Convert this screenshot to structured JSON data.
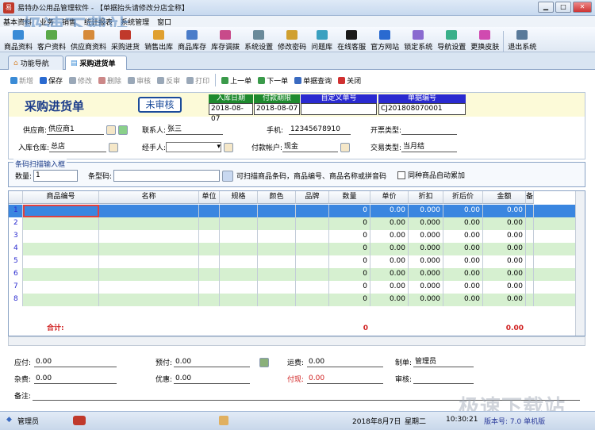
{
  "window": {
    "title": "易特办公用品管理软件 - 【单据抬头请修改分店全称】"
  },
  "watermark": "极速下载站",
  "menu": [
    "基本资料",
    "业务",
    "销售",
    "统计报表",
    "系统管理",
    "窗口"
  ],
  "toolbar": [
    {
      "label": "商品资料",
      "icon": "goods-icon",
      "color": "#3a8bd6"
    },
    {
      "label": "客户资料",
      "icon": "customer-icon",
      "color": "#5aa94a"
    },
    {
      "label": "供应商资料",
      "icon": "supplier-icon",
      "color": "#d68a3a"
    },
    {
      "label": "采购进货",
      "icon": "purchase-icon",
      "color": "#c0392b"
    },
    {
      "label": "销售出库",
      "icon": "sales-icon",
      "color": "#e0a030"
    },
    {
      "label": "商品库存",
      "icon": "stock-icon",
      "color": "#4a7cc9"
    },
    {
      "label": "库存调拨",
      "icon": "transfer-icon",
      "color": "#c84a8a"
    },
    {
      "label": "系统设置",
      "icon": "settings-icon",
      "color": "#6a8a9a"
    },
    {
      "label": "修改密码",
      "icon": "password-icon",
      "color": "#d0a030"
    },
    {
      "label": "问题库",
      "icon": "question-icon",
      "color": "#3aa0c0"
    },
    {
      "label": "在线客服",
      "icon": "service-icon",
      "color": "#1a1a1a"
    },
    {
      "label": "官方网站",
      "icon": "website-icon",
      "color": "#2a6ad0"
    },
    {
      "label": "锁定系统",
      "icon": "lock-icon",
      "color": "#8a6ad0"
    },
    {
      "label": "导航设置",
      "icon": "nav-icon",
      "color": "#3ab08a"
    },
    {
      "label": "更换皮肤",
      "icon": "skin-icon",
      "color": "#d04ab0"
    },
    {
      "label": "退出系统",
      "icon": "exit-icon",
      "color": "#5a7a9a"
    }
  ],
  "tabs": [
    {
      "label": "功能导航"
    },
    {
      "label": "采购进货单"
    }
  ],
  "subtoolbar": [
    {
      "label": "新增",
      "color": "#3a8bd6",
      "disabled": true
    },
    {
      "label": "保存",
      "color": "#2a6ad0",
      "disabled": false
    },
    {
      "label": "修改",
      "color": "#9aa8b8",
      "disabled": true
    },
    {
      "label": "删除",
      "color": "#c88",
      "disabled": true
    },
    {
      "label": "审核",
      "color": "#9aa8b8",
      "disabled": true
    },
    {
      "label": "反审",
      "color": "#9aa8b8",
      "disabled": true
    },
    {
      "label": "打印",
      "color": "#9aa8b8",
      "disabled": true
    },
    {
      "label": "上一单",
      "color": "#3a9a4a",
      "disabled": false
    },
    {
      "label": "下一单",
      "color": "#3a9a4a",
      "disabled": false
    },
    {
      "label": "单据查询",
      "color": "#3a6ac0",
      "disabled": false
    },
    {
      "label": "关闭",
      "color": "#d03030",
      "disabled": false
    }
  ],
  "doc": {
    "title": "采购进货单",
    "status": "未审核",
    "date_label": "入库日期",
    "date_value": "2018-08-07",
    "pay_date_label": "付款期限",
    "pay_date_value": "2018-08-07",
    "custom_no_label": "自定义单号",
    "custom_no_value": "",
    "doc_no_label": "单据编号",
    "doc_no_value": "CJ201808070001"
  },
  "form": {
    "supplier_label": "供应商:",
    "supplier_value": "供应商1",
    "contact_label": "联系人:",
    "contact_value": "张三",
    "phone_label": "手机:",
    "phone_value": "12345678910",
    "invoice_label": "开票类型:",
    "invoice_value": "",
    "warehouse_label": "入库仓库:",
    "warehouse_value": "总店",
    "handler_label": "经手人:",
    "handler_value": "",
    "account_label": "付款帐户:",
    "account_value": "现金",
    "trade_label": "交易类型:",
    "trade_value": "当月结"
  },
  "scan": {
    "legend": "条码扫描输入框",
    "qty_label": "数量:",
    "qty_value": "1",
    "barcode_label": "条型码:",
    "hint": "可扫描商品条码，商品编号、商品名称或拼音码",
    "merge_label": "同种商品自动累加"
  },
  "grid": {
    "headers": [
      "",
      "商品编号",
      "名称",
      "单位",
      "规格",
      "颜色",
      "品牌",
      "数量",
      "单价",
      "折扣",
      "折后价",
      "金额",
      "备"
    ],
    "row_numbers": [
      "1",
      "2",
      "3",
      "4",
      "5",
      "6",
      "7",
      "8"
    ],
    "qty": "0",
    "price": "0.00",
    "discount": "0.000",
    "disc_price": "0.00",
    "amount": "0.00",
    "total_label": "合计:",
    "total_qty": "0",
    "total_amount": "0.00"
  },
  "footer": {
    "payable_label": "应付:",
    "payable_value": "0.00",
    "prepaid_label": "预付:",
    "prepaid_value": "0.00",
    "freight_label": "运费:",
    "freight_value": "0.00",
    "maker_label": "制单:",
    "maker_value": "管理员",
    "misc_label": "杂费:",
    "misc_value": "0.00",
    "discount_label": "优惠:",
    "discount_value": "0.00",
    "paid_label": "付现:",
    "paid_value": "0.00",
    "auditor_label": "审核:",
    "auditor_value": "",
    "remark_label": "备注:"
  },
  "status": {
    "user": "管理员",
    "date": "2018年8月7日",
    "weekday": "星期二",
    "time": "10:30:21",
    "version": "版本号: 7.0 单机版"
  }
}
